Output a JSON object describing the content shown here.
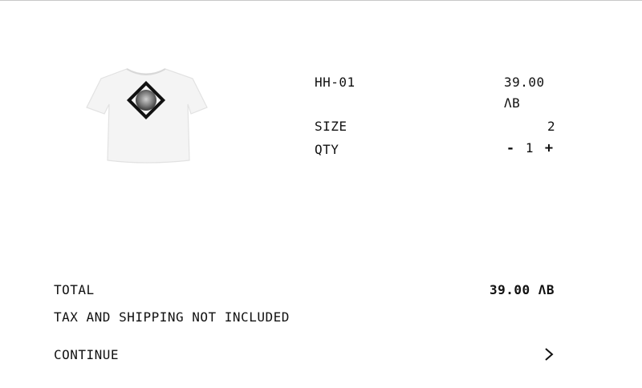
{
  "product": {
    "image_icon": "tshirt-graphic-icon",
    "sku": "HH-01",
    "price": "39.00",
    "currency": "ΛB",
    "size_label": "SIZE",
    "size_value": "2",
    "qty_label": "QTY",
    "qty_decrement": "-",
    "qty_value": "1",
    "qty_increment": "+"
  },
  "summary": {
    "total_label": "TOTAL",
    "total_value": "39.00 ΛB",
    "tax_note": "TAX AND SHIPPING NOT INCLUDED",
    "continue_label": "CONTINUE",
    "continue_icon": "chevron-right-icon"
  }
}
